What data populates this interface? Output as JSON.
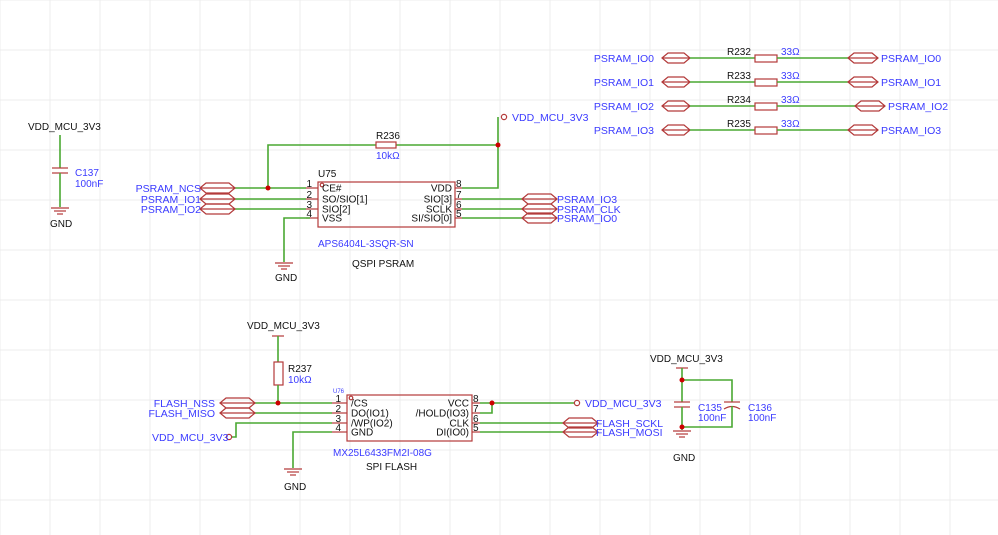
{
  "colors": {
    "wire": "#4aa832",
    "component": "#b33a3a",
    "label": "#3b3bff",
    "junction": "#cc0000"
  },
  "power": {
    "vdd": "VDD_MCU_3V3",
    "gnd": "GND"
  },
  "c137": {
    "ref": "C137",
    "value": "100nF"
  },
  "psram": {
    "ref": "U75",
    "part": "APS6404L-3SQR-SN",
    "title": "QSPI PSRAM",
    "r_ref": "R236",
    "r_value": "10kΩ",
    "left_pins": [
      {
        "num": "1",
        "name": "CE#",
        "net": "PSRAM_NCS"
      },
      {
        "num": "2",
        "name": "SO/SIO[1]",
        "net": "PSRAM_IO1"
      },
      {
        "num": "3",
        "name": "SIO[2]",
        "net": "PSRAM_IO2"
      },
      {
        "num": "4",
        "name": "VSS",
        "net": ""
      }
    ],
    "right_pins": [
      {
        "num": "8",
        "name": "VDD",
        "net": ""
      },
      {
        "num": "7",
        "name": "SIO[3]",
        "net": "PSRAM_IO3"
      },
      {
        "num": "6",
        "name": "SCLK",
        "net": "PSRAM_CLK"
      },
      {
        "num": "5",
        "name": "SI/SIO[0]",
        "net": "PSRAM_IO0"
      }
    ]
  },
  "series_resistors": [
    {
      "ref": "R232",
      "value": "33Ω",
      "left": "PSRAM_IO0",
      "right": "PSRAM_IO0"
    },
    {
      "ref": "R233",
      "value": "33Ω",
      "left": "PSRAM_IO1",
      "right": "PSRAM_IO1"
    },
    {
      "ref": "R234",
      "value": "33Ω",
      "left": "PSRAM_IO2",
      "right": "PSRAM_IO2"
    },
    {
      "ref": "R235",
      "value": "33Ω",
      "left": "PSRAM_IO3",
      "right": "PSRAM_IO3"
    }
  ],
  "flash": {
    "ref": "U76",
    "part": "MX25L6433FM2I-08G",
    "title": "SPI FLASH",
    "r_ref": "R237",
    "r_value": "10kΩ",
    "left_pins": [
      {
        "num": "1",
        "name": "/CS",
        "net": "FLASH_NSS"
      },
      {
        "num": "2",
        "name": "DO(IO1)",
        "net": "FLASH_MISO"
      },
      {
        "num": "3",
        "name": "/WP(IO2)",
        "net": "VDD_MCU_3V3"
      },
      {
        "num": "4",
        "name": "GND",
        "net": ""
      }
    ],
    "right_pins": [
      {
        "num": "8",
        "name": "VCC",
        "net": "VDD_MCU_3V3"
      },
      {
        "num": "7",
        "name": "/HOLD(IO3)",
        "net": ""
      },
      {
        "num": "6",
        "name": "CLK",
        "net": "FLASH_SCKL"
      },
      {
        "num": "5",
        "name": "DI(IO0)",
        "net": "FLASH_MOSI"
      }
    ]
  },
  "decoupling": [
    {
      "ref": "C135",
      "value": "100nF"
    },
    {
      "ref": "C136",
      "value": "100nF"
    }
  ]
}
